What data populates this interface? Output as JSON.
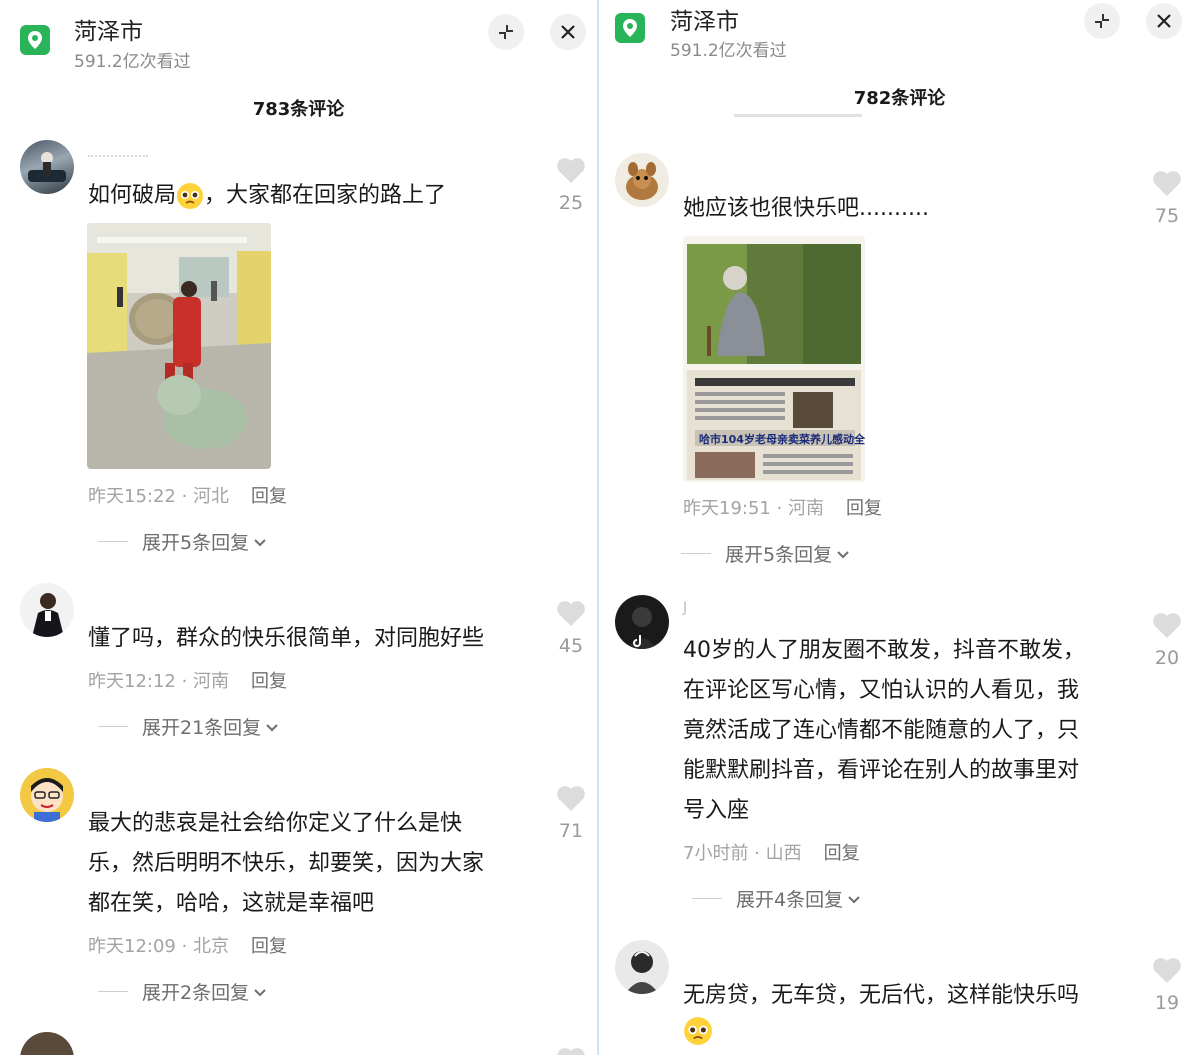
{
  "left": {
    "location": {
      "title": "菏泽市",
      "views": "591.2亿次看过"
    },
    "comment_count": "783条评论",
    "comments": [
      {
        "text_a": "如何破局",
        "text_b": "，大家都在回家的路上了",
        "meta": "昨天15:22 · 河北",
        "reply": "回复",
        "expand": "展开5条回复",
        "likes": "25"
      },
      {
        "text": "懂了吗，群众的快乐很简单，对同胞好些",
        "meta": "昨天12:12 · 河南",
        "reply": "回复",
        "expand": "展开21条回复",
        "likes": "45"
      },
      {
        "lines": [
          "最大的悲哀是社会给你定义了什么是快",
          "乐，然后明明不快乐，却要笑，因为大家",
          "都在笑，哈哈，这就是幸福吧"
        ],
        "meta": "昨天12:09 · 北京",
        "reply": "回复",
        "expand": "展开2条回复",
        "likes": "71"
      }
    ]
  },
  "right": {
    "location": {
      "title": "菏泽市",
      "views": "591.2亿次看过"
    },
    "comment_count": "782条评论",
    "comments": [
      {
        "text": "她应该也很快乐吧..........",
        "meta": "昨天19:51 · 河南",
        "reply": "回复",
        "expand": "展开5条回复",
        "likes": "75",
        "image_caption": "哈市104岁老母亲卖菜养儿感动全国"
      },
      {
        "username": "J",
        "lines": [
          "40岁的人了朋友圈不敢发，抖音不敢发，",
          "在评论区写心情，又怕认识的人看见，我",
          "竟然活成了连心情都不能随意的人了，只",
          "能默默刷抖音，看评论在别人的故事里对",
          "号入座"
        ],
        "meta": "7小时前 · 山西",
        "reply": "回复",
        "expand": "展开4条回复",
        "likes": "20"
      },
      {
        "text": "无房贷，无车贷，无后代，这样能快乐吗",
        "meta": "",
        "likes": "19"
      }
    ]
  },
  "colors": {
    "location_green": "#29b45a",
    "meta_gray": "#a3a3a3",
    "divider": "#cfe3f2"
  },
  "icons": [
    "location-pin-icon",
    "minimize-icon",
    "close-icon",
    "heart-icon",
    "chevron-down-icon",
    "pleading-face-emoji"
  ]
}
